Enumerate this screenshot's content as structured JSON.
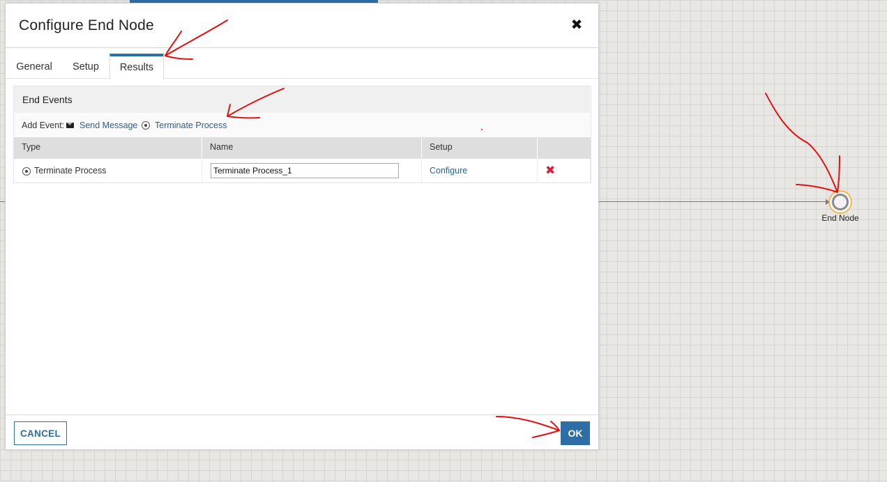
{
  "dialog": {
    "title": "Configure End Node",
    "close_icon": "close-icon"
  },
  "tabs": [
    {
      "label": "General",
      "active": false
    },
    {
      "label": "Setup",
      "active": false
    },
    {
      "label": "Results",
      "active": true
    }
  ],
  "end_events": {
    "title": "End Events",
    "add_event_label": "Add Event:",
    "add_options": [
      {
        "icon": "envelope-icon",
        "label": "Send Message"
      },
      {
        "icon": "radio-target-icon",
        "label": "Terminate Process"
      }
    ],
    "columns": [
      "Type",
      "Name",
      "Setup",
      ""
    ],
    "rows": [
      {
        "type_icon": "radio-target-icon",
        "type": "Terminate Process",
        "name": "Terminate Process_1",
        "setup_link": "Configure",
        "delete_icon": "delete-x-icon"
      }
    ]
  },
  "footer": {
    "cancel_label": "CANCEL",
    "ok_label": "OK"
  },
  "canvas": {
    "end_node_label": "End Node"
  },
  "colors": {
    "accent": "#2e6ea6",
    "link": "#2a5f96",
    "delete": "#d2233b",
    "node_outline": "#f0b757",
    "annotation": "#e11010"
  }
}
